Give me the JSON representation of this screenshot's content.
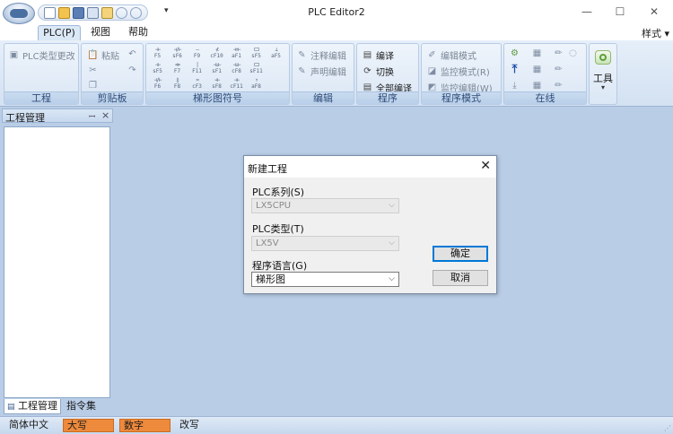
{
  "window": {
    "title": "PLC Editor2",
    "minimize_glyph": "—",
    "maximize_glyph": "☐",
    "close_glyph": "✕"
  },
  "quick_access": {
    "icons": [
      "new-file-icon",
      "open-folder-icon",
      "save-icon",
      "print-preview-icon",
      "new-project-icon",
      "undo-icon",
      "redo-icon"
    ],
    "more_glyph": "▾"
  },
  "tabs": [
    {
      "label": "PLC(P)",
      "active": true
    },
    {
      "label": "视图",
      "active": false
    },
    {
      "label": "帮助",
      "active": false
    }
  ],
  "style_menu": "样式 ▾",
  "ribbon": {
    "project": {
      "label": "工程",
      "change_type": "PLC类型更改"
    },
    "clipboard": {
      "label": "剪贴板",
      "paste": "粘贴"
    },
    "ladder_symbols": {
      "label": "梯形图符号",
      "rows": [
        [
          [
            "⊣⊢",
            "F5"
          ],
          [
            "⊣/⊢",
            "sF6"
          ],
          [
            "—",
            "F9"
          ],
          [
            "⊀",
            "cF10"
          ],
          [
            "⊣↑⊢",
            "aF1"
          ],
          [
            "⊏⊐",
            "sF5"
          ],
          [
            "⊥",
            "aF5"
          ]
        ],
        [
          [
            "⊣⊢",
            "sF5"
          ],
          [
            "⊲⊳",
            "F7"
          ],
          [
            "|",
            "F11"
          ],
          [
            "⊣↓⊢",
            "sF1"
          ],
          [
            "⊣↓⊢",
            "cF8"
          ],
          [
            "⊏⊐",
            "sF11"
          ]
        ],
        [
          [
            "⊣/⊢",
            "F6"
          ],
          [
            "⟮⟯",
            "F8"
          ],
          [
            "≍",
            "cF3"
          ],
          [
            "⊣⊢",
            "sF8"
          ],
          [
            "⊣⊢",
            "cF11"
          ],
          [
            "↑",
            "aF8"
          ]
        ]
      ]
    },
    "edit": {
      "label": "编辑",
      "comment_edit": "注释编辑",
      "declaration_edit": "声明编辑"
    },
    "program": {
      "label": "程序",
      "compile": "编译",
      "switch": "切换",
      "compile_all": "全部编译"
    },
    "program_mode": {
      "label": "程序模式",
      "edit_mode": "编辑模式",
      "monitor_mode": "监控模式(R)",
      "monitor_edit": "监控编辑(W)"
    },
    "online": {
      "label": "在线"
    },
    "tools": {
      "label": "工具",
      "more_glyph": "▾"
    }
  },
  "project_panel": {
    "title": "工程管理",
    "pin_glyph": "ꟷ",
    "close_glyph": "×",
    "tabs": [
      "工程管理",
      "指令集"
    ]
  },
  "statusbar": {
    "language": "简体中文",
    "caps": "大写",
    "num": "数字",
    "overwrite": "改写",
    "grip": "⋰"
  },
  "dialog": {
    "title": "新建工程",
    "close_glyph": "✕",
    "plc_series_label": "PLC系列(S)",
    "plc_series_value": "LX5CPU",
    "plc_type_label": "PLC类型(T)",
    "plc_type_value": "LX5V",
    "language_label": "程序语言(G)",
    "language_value": "梯形图",
    "arrow_glyph": "⌵",
    "ok_label": "确定",
    "cancel_label": "取消"
  },
  "colors": {
    "workspace": "#b9cde6",
    "accent": "#0078d7",
    "status_highlight": "#ee8a3c"
  }
}
